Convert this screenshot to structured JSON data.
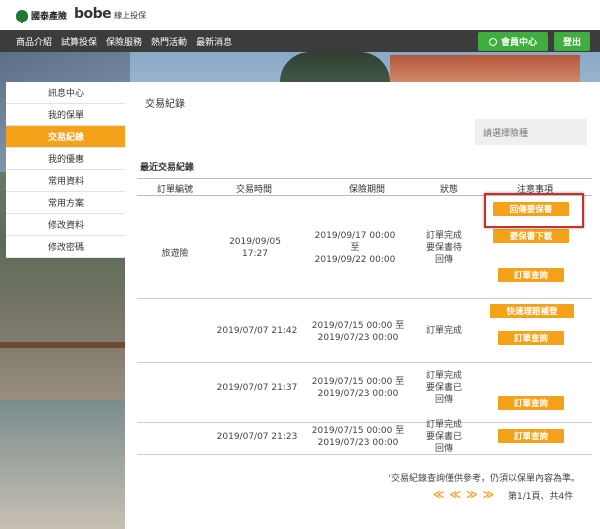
{
  "brand": {
    "company": "國泰產險",
    "logo": "bobe",
    "logo_sub": "線上投保"
  },
  "nav": {
    "items": [
      "商品介紹",
      "試算投保",
      "保險服務",
      "熱門活動",
      "最新消息"
    ]
  },
  "header": {
    "member_label": "會員中心",
    "logout_label": "登出"
  },
  "sidebar": {
    "items": [
      {
        "label": "訊息中心"
      },
      {
        "label": "我的保單"
      },
      {
        "label": "交易紀錄",
        "active": true
      },
      {
        "label": "我的優惠"
      },
      {
        "label": "常用資料"
      },
      {
        "label": "常用方案"
      },
      {
        "label": "修改資料"
      },
      {
        "label": "修改密碼"
      }
    ]
  },
  "main": {
    "title": "交易紀錄",
    "select_placeholder": "請選擇險種",
    "section_title": "最近交易紀錄",
    "columns": [
      "訂單編號",
      "交易時間",
      "保險期間",
      "狀態",
      "注意事項"
    ],
    "rows": [
      {
        "order": "旅遊險",
        "time": "2019/09/05 17:27",
        "period_start": "2019/09/17 00:00",
        "period_sep": "至",
        "period_end": "2019/09/22 00:00",
        "status": "訂單完成 要保書待回傳",
        "actions": [
          "回傳要保書",
          "要保書下載",
          "訂單查詢"
        ]
      },
      {
        "order": "",
        "time": "2019/07/07 21:42",
        "period_start": "2019/07/15 00:00 至",
        "period_end": "2019/07/23 00:00",
        "status": "訂單完成",
        "actions": [
          "快速理賠補登",
          "訂單查詢"
        ]
      },
      {
        "order": "",
        "time": "2019/07/07 21:37",
        "period_start": "2019/07/15 00:00 至",
        "period_end": "2019/07/23 00:00",
        "status": "訂單完成 要保書已回傳",
        "actions": [
          "訂單查詢"
        ]
      },
      {
        "order": "",
        "time": "2019/07/07 21:23",
        "period_start": "2019/07/15 00:00 至",
        "period_end": "2019/07/23 00:00",
        "status": "訂單完成 要保書已回傳",
        "actions": [
          "訂單查詢"
        ]
      }
    ],
    "note": "'交易紀錄查詢僅供參考，仍須以保單內容為準。",
    "pager_arrows": [
      "≪",
      "≪",
      "≫",
      "≫"
    ],
    "page_info": "第1/1頁、共4件"
  },
  "colors": {
    "accent": "#f5a21b",
    "green": "#3fae3f",
    "nav_bg": "#3c3c3c",
    "highlight": "#c62f2f"
  }
}
